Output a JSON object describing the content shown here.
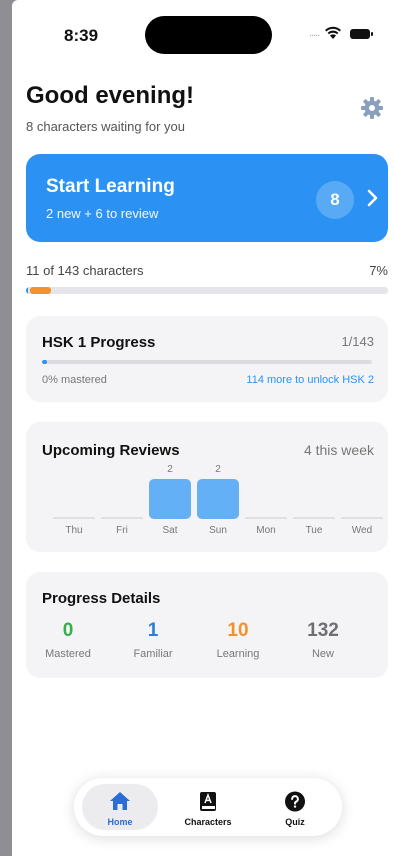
{
  "status_bar": {
    "time": "8:39",
    "signal": "....."
  },
  "header": {
    "greeting": "Good evening!",
    "subtitle": "8 characters waiting for you"
  },
  "start_card": {
    "title": "Start Learning",
    "subtitle": "2 new + 6 to review",
    "count": "8"
  },
  "overall": {
    "label": "11 of 143 characters",
    "percent": "7%",
    "mastered_fraction": 0.01,
    "learning_fraction": 0.07
  },
  "hsk": {
    "title": "HSK 1 Progress",
    "count": "1/143",
    "mastered": "0% mastered",
    "unlock": "114 more to unlock HSK 2",
    "fill_fraction": 0.015
  },
  "reviews": {
    "title": "Upcoming Reviews",
    "count": "4 this week",
    "days": [
      {
        "name": "Thu",
        "value": 0,
        "label": ""
      },
      {
        "name": "Fri",
        "value": 0,
        "label": ""
      },
      {
        "name": "Sat",
        "value": 2,
        "label": "2"
      },
      {
        "name": "Sun",
        "value": 2,
        "label": "2"
      },
      {
        "name": "Mon",
        "value": 0,
        "label": ""
      },
      {
        "name": "Tue",
        "value": 0,
        "label": ""
      },
      {
        "name": "Wed",
        "value": 0,
        "label": ""
      }
    ]
  },
  "details": {
    "title": "Progress Details",
    "stats": [
      {
        "value": "0",
        "label": "Mastered",
        "color": "#34b04a"
      },
      {
        "value": "1",
        "label": "Familiar",
        "color": "#2b7fd6"
      },
      {
        "value": "10",
        "label": "Learning",
        "color": "#f5902a"
      },
      {
        "value": "132",
        "label": "New",
        "color": "#6e6e73"
      }
    ]
  },
  "tabs": [
    {
      "label": "Home",
      "icon": "home-icon",
      "active": true
    },
    {
      "label": "Characters",
      "icon": "book-icon",
      "active": false
    },
    {
      "label": "Quiz",
      "icon": "question-icon",
      "active": false
    }
  ],
  "colors": {
    "accent": "#2b92f3",
    "orange": "#f5902a",
    "gear": "#8aa0bf"
  }
}
